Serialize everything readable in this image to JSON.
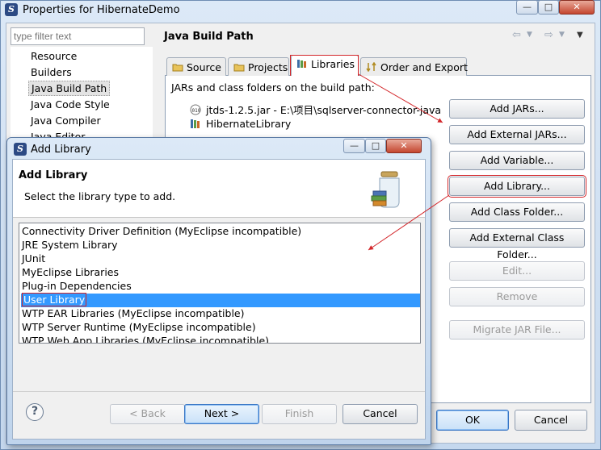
{
  "outer_window": {
    "title": "Properties for HibernateDemo",
    "filter_placeholder": "type filter text",
    "tree_items": [
      "Resource",
      "Builders",
      "Java Build Path",
      "Java Code Style",
      "Java Compiler",
      "Java Editor"
    ],
    "selected_tree_item": "Java Build Path",
    "panel_title": "Java Build Path",
    "tabs": [
      {
        "label": "Source",
        "icon": "source-folder-icon"
      },
      {
        "label": "Projects",
        "icon": "projects-folder-icon"
      },
      {
        "label": "Libraries",
        "icon": "libraries-icon"
      },
      {
        "label": "Order and Export",
        "icon": "order-export-icon"
      }
    ],
    "active_tab": "Libraries",
    "jars_label": "JARs and class folders on the build path:",
    "jars": [
      {
        "label": "jtds-1.2.5.jar - E:\\项目\\sqlserver-connector-java",
        "icon": "jar-icon"
      },
      {
        "label": "HibernateLibrary",
        "icon": "library-icon"
      }
    ],
    "buttons": [
      {
        "label": "Add JARs...",
        "enabled": true
      },
      {
        "label": "Add External JARs...",
        "enabled": true
      },
      {
        "label": "Add Variable...",
        "enabled": true
      },
      {
        "label": "Add Library...",
        "enabled": true,
        "highlighted": true
      },
      {
        "label": "Add Class Folder...",
        "enabled": true
      },
      {
        "label": "Add External Class Folder...",
        "enabled": true
      },
      {
        "label": "Edit...",
        "enabled": false
      },
      {
        "label": "Remove",
        "enabled": false
      },
      {
        "label": "Migrate JAR File...",
        "enabled": false
      }
    ],
    "ok_label": "OK",
    "cancel_label": "Cancel"
  },
  "dialog": {
    "title": "Add Library",
    "heading": "Add Library",
    "description": "Select the library type to add.",
    "library_types": [
      "Connectivity Driver Definition (MyEclipse incompatible)",
      "JRE System Library",
      "JUnit",
      "MyEclipse Libraries",
      "Plug-in Dependencies",
      "User Library",
      "WTP EAR Libraries (MyEclipse incompatible)",
      "WTP Server Runtime (MyEclipse incompatible)",
      "WTP Web App Libraries (MyEclipse incompatible)"
    ],
    "selected_type": "User Library",
    "back_label": "< Back",
    "next_label": "Next >",
    "finish_label": "Finish",
    "cancel_label": "Cancel"
  },
  "colors": {
    "selection": "#3399ff",
    "annotation_red": "#d3262a",
    "window_frame": "#c9dcf0"
  }
}
